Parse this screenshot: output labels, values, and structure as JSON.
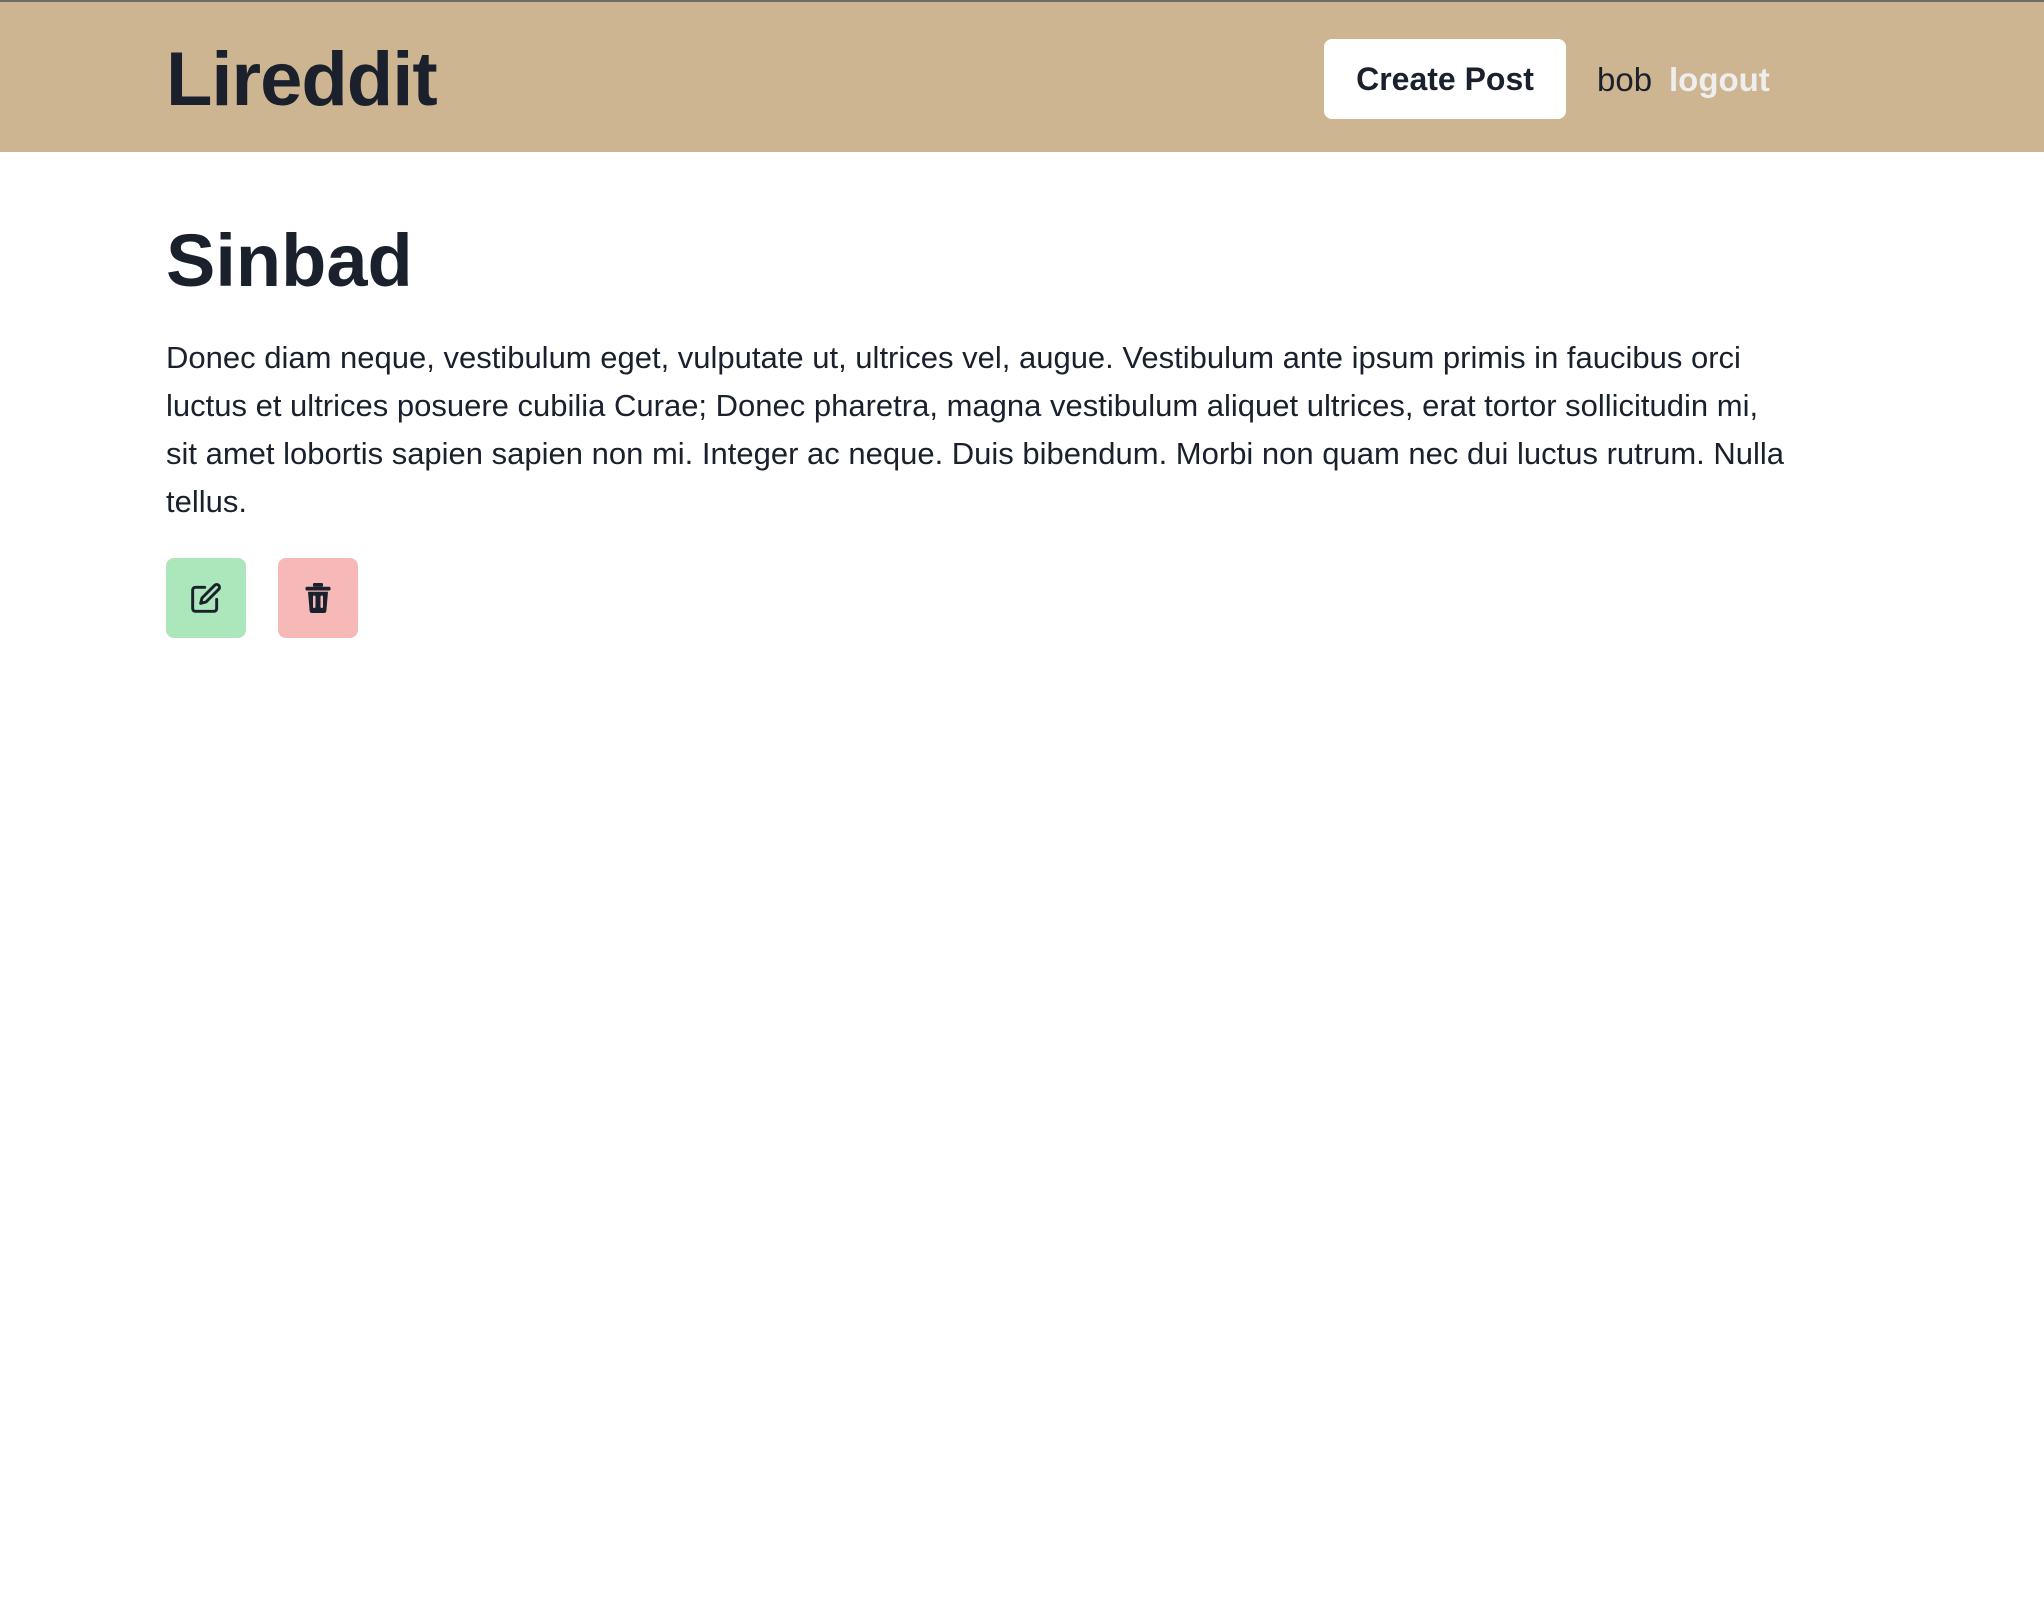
{
  "navbar": {
    "logo": "Lireddit",
    "create_post_label": "Create Post",
    "username": "bob",
    "logout_label": "logout"
  },
  "post": {
    "title": "Sinbad",
    "body": "Donec diam neque, vestibulum eget, vulputate ut, ultrices vel, augue. Vestibulum ante ipsum primis in faucibus orci luctus et ultrices posuere cubilia Curae; Donec pharetra, magna vestibulum aliquet ultrices, erat tortor sollicitudin mi, sit amet lobortis sapien sapien non mi. Integer ac neque. Duis bibendum. Morbi non quam nec dui luctus rutrum. Nulla tellus."
  },
  "actions": {
    "edit_icon": "edit-icon",
    "delete_icon": "trash-icon"
  },
  "colors": {
    "navbar_bg": "#ceb591",
    "edit_bg": "#ace6bb",
    "delete_bg": "#f7b8b8",
    "logout_text": "#eeeeee",
    "text": "#1a202c"
  }
}
